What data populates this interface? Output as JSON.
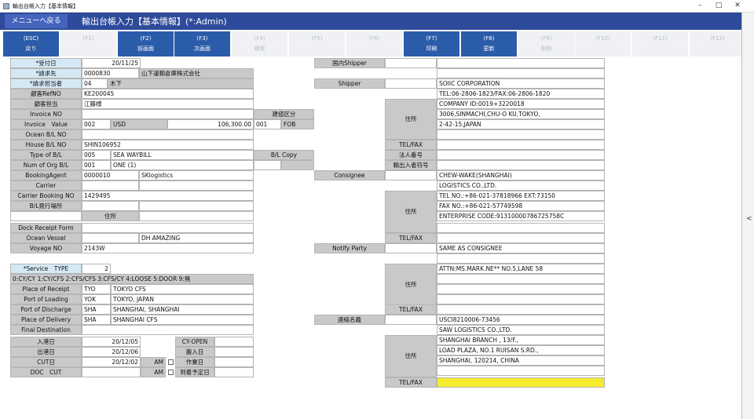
{
  "window": {
    "title": "輸出台帳入力【基本情報】"
  },
  "header": {
    "menu_back": "メニューへ戻る",
    "title": "輸出台帳入力【基本情報】(*:Admin)"
  },
  "fkeys": [
    {
      "key": "(ESC)",
      "label": "戻り",
      "enabled": true
    },
    {
      "key": "(F1)",
      "label": "",
      "enabled": false
    },
    {
      "key": "(F2)",
      "label": "前画面",
      "enabled": true
    },
    {
      "key": "(F3)",
      "label": "次画面",
      "enabled": true
    },
    {
      "key": "(F4)",
      "label": "検索",
      "enabled": false
    },
    {
      "key": "(F5)",
      "label": "",
      "enabled": false
    },
    {
      "key": "(F6)",
      "label": "",
      "enabled": false
    },
    {
      "key": "(F7)",
      "label": "印刷",
      "enabled": true
    },
    {
      "key": "(F8)",
      "label": "更新",
      "enabled": true
    },
    {
      "key": "(F9)",
      "label": "削除",
      "enabled": false
    },
    {
      "key": "(F10)",
      "label": "",
      "enabled": false
    },
    {
      "key": "(F11)",
      "label": "",
      "enabled": false
    },
    {
      "key": "(F12)",
      "label": "",
      "enabled": false
    }
  ],
  "left": {
    "receipt_date_label": "*受付日",
    "receipt_date": "20/11/25",
    "billing_label": "*請求先",
    "billing_code": "0000830",
    "billing_name": "山下運輸倉庫株式会社",
    "staff_label": "*請求担当者",
    "staff_code": "04",
    "staff_name": "木下",
    "cust_ref_label": "顧客RefNO",
    "cust_ref": "KE200045",
    "cust_staff_label": "顧客担当",
    "cust_staff": "江藤様",
    "invoice_no_label": "Invoice NO",
    "bonded_label": "建値区分",
    "invoice_value_label": "Invoice　Value",
    "inv_code": "002",
    "inv_currency": "USD",
    "inv_amount": "106,300.00",
    "inv_term_code": "001",
    "inv_term": "FOB",
    "ocean_bl_label": "Ocean B/L NO",
    "house_bl_label": "House B/L NO",
    "house_bl": "SHIN106952",
    "type_bl_label": "Type of B/L",
    "type_bl_code": "005",
    "type_bl_name": "SEA WAYBILL",
    "bl_copy_label": "B/L Copy",
    "num_bl_label": "Num of Org B/L",
    "num_bl_code": "001",
    "num_bl_name": "ONE (1)",
    "booking_agent_label": "BookingAgent",
    "booking_agent_code": "0000010",
    "booking_agent_name": "SKlogistics",
    "carrier_label": "Carrier",
    "carrier_booking_label": "Carrier Booking NO",
    "carrier_booking": "1429495",
    "bl_place_label": "B/L発行場所",
    "address_label": "住所",
    "dock_receipt_label": "Dock Receipt Form",
    "vessel_label": "Ocean Vessel",
    "vessel": "DH AMAZING",
    "voyage_label": "Voyage NO",
    "voyage": "2143W",
    "service_type_label": "*Service　TYPE",
    "service_type": "2",
    "service_types_text": "0:CY/CY  1:CY/CFS  2:CFS/CFS  3:CFS/CY  4:LOOSE  5:DOOR  9:無",
    "place_receipt_label": "Place of Receipt",
    "place_receipt_code": "TYO",
    "place_receipt_name": "TOKYO CFS",
    "port_loading_label": "Port of Loading",
    "port_loading_code": "YOK",
    "port_loading_name": "TOKYO, JAPAN",
    "port_discharge_label": "Port of Discharge",
    "port_discharge_code": "SHA",
    "port_discharge_name": "SHANGHAI, SHANGHAI",
    "place_delivery_label": "Place of Delivery",
    "place_delivery_code": "SHA",
    "place_delivery_name": "SHANGHAI CFS",
    "final_dest_label": "Final Destination",
    "in_date_label": "入港日",
    "in_date": "20/12/05",
    "cy_open_label": "CY-OPEN",
    "out_date_label": "出港日",
    "out_date": "20/12/06",
    "carry_in_label": "搬入日",
    "cut_date_label": "CUT日",
    "cut_date": "20/12/02",
    "cut_am": "AM",
    "work_date_label": "作業日",
    "doc_cut_label": "DOC　CUT",
    "doc_am": "AM",
    "arrival_label": "到着予定日"
  },
  "right": {
    "domestic_shipper_label": "国内Shipper",
    "shipper_label": "Shipper",
    "shipper_name": "SOIIC CORPORATION",
    "shipper_tel": "TEL:06-2806-1823/FAX:06-2806-1820",
    "shipper_addr_label": "住所",
    "shipper_addr1": "COMPANY ID:0019+3220018",
    "shipper_addr2": "3006,SINMACHI,CHU-O KU,TOKYO,",
    "shipper_addr3": "2-42-15,JAPAN",
    "shipper_telfax_label": "TEL/FAX",
    "corp_no_label": "法人番号",
    "exporter_code_label": "輸出入者符号",
    "consignee_label": "Consignee",
    "consignee_name": "CHEW-WAKE(SHANGHAI)",
    "consignee_name2": "LOGISTICS CO.,LTD.",
    "consignee_addr_label": "住所",
    "consignee_addr1": "TEL NO.:+86-021-37818966 EXT:73150",
    "consignee_addr2": "FAX NO.:+86-021-57749598",
    "consignee_addr3": "ENTERPRISE  CODE:91310000786725758C",
    "consignee_telfax_label": "TEL/FAX",
    "notify_label": "Notify Party",
    "notify_name": "SAME AS CONSIGNEE",
    "notify_addr_label": "住所",
    "notify_addr1": "ATTN:MS.MARK.NE** NO.5,LANE 58",
    "notify_telfax_label": "TEL/FAX",
    "agent_label": "連絡名義",
    "agent_code": "USCI8210006-73456",
    "agent_name": "SAW LOGISTICS CO.,LTD.",
    "agent_addr_label": "住所",
    "agent_addr1": "SHANGHAI BRANCH  , 13/F.,",
    "agent_addr2": "LOAD PLAZA, NO.1 RUISAN S.RD.,",
    "agent_addr3": "SHANGHAI, 120214, CHINA",
    "agent_telfax_label": "TEL/FAX"
  }
}
